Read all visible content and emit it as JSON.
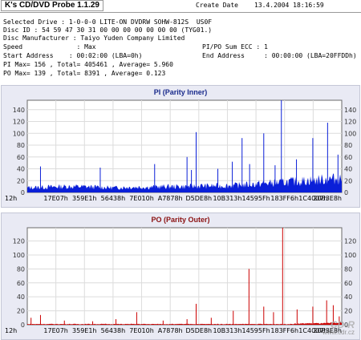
{
  "app": {
    "title": "K's CD/DVD Probe 1.1.29",
    "create_date_label": "Create Date",
    "create_date_value": "13.4.2004 18:16:59"
  },
  "info": {
    "selected_drive": "Selected Drive : 1-0-0-0 LITE-ON DVDRW SOHW-812S  US0F",
    "disc_id": "Disc ID : 54 59 47 30 31 00 00 00 00 00 00 00 (TYG01.)",
    "disc_manufacturer": "Disc Manufacturer : Taiyo Yuden Company Limited",
    "speed": "Speed              : Max",
    "pipo_sum": "PI/PO Sum ECC : 1",
    "start_address": "Start Address    : 00:02:00 (LBA=0h)",
    "end_address": "End Address     : 00:00:00 (LBA=20FFDDh)",
    "pi_stats": "PI Max= 156 , Total= 405461 , Average= 5.960",
    "po_stats": "PO Max= 139 , Total= 8391 , Average= 0.123"
  },
  "chart_data": [
    {
      "type": "bar",
      "title": "PI (Parity Inner)",
      "color": "#0a1fd8",
      "y_ticks": [
        0,
        20,
        40,
        60,
        80,
        100,
        120,
        140
      ],
      "ylim": [
        0,
        156
      ],
      "x_tick_labels": [
        "12h",
        "17E07h",
        "359E1h",
        "56438h",
        "7E010h",
        "A7878h",
        "D5DE8h",
        "10B313h",
        "14595Fh",
        "183FF6h",
        "1C4007h",
        "2083E8h"
      ],
      "baseline": [
        8,
        9,
        10,
        10,
        9,
        8,
        9,
        9,
        10,
        10,
        11,
        11,
        12,
        14,
        16,
        18,
        20,
        22,
        24
      ],
      "spikes": [
        {
          "x": 0.042,
          "value": 44
        },
        {
          "x": 0.232,
          "value": 42
        },
        {
          "x": 0.405,
          "value": 48
        },
        {
          "x": 0.508,
          "value": 60
        },
        {
          "x": 0.522,
          "value": 38
        },
        {
          "x": 0.537,
          "value": 102
        },
        {
          "x": 0.606,
          "value": 40
        },
        {
          "x": 0.652,
          "value": 52
        },
        {
          "x": 0.683,
          "value": 92
        },
        {
          "x": 0.707,
          "value": 48
        },
        {
          "x": 0.752,
          "value": 100
        },
        {
          "x": 0.788,
          "value": 46
        },
        {
          "x": 0.808,
          "value": 156
        },
        {
          "x": 0.856,
          "value": 56
        },
        {
          "x": 0.908,
          "value": 92
        },
        {
          "x": 0.955,
          "value": 118
        },
        {
          "x": 0.988,
          "value": 64
        }
      ]
    },
    {
      "type": "bar",
      "title": "PO (Parity Outer)",
      "color": "#cc0000",
      "y_ticks": [
        0,
        20,
        40,
        60,
        80,
        100,
        120
      ],
      "ylim": [
        0,
        139
      ],
      "x_tick_labels": [
        "12h",
        "17E07h",
        "359E1h",
        "56438h",
        "7E010h",
        "A7878h",
        "D5DE8h",
        "10B313h",
        "14595Fh",
        "183FF6h",
        "1C4007h",
        "2083E8h"
      ],
      "baseline": [
        1,
        1,
        1,
        1,
        1,
        1,
        1,
        1,
        1,
        1,
        1,
        1,
        1,
        1,
        1,
        1,
        2,
        2,
        3
      ],
      "spikes": [
        {
          "x": 0.012,
          "value": 10
        },
        {
          "x": 0.042,
          "value": 14
        },
        {
          "x": 0.118,
          "value": 6
        },
        {
          "x": 0.208,
          "value": 5
        },
        {
          "x": 0.282,
          "value": 8
        },
        {
          "x": 0.348,
          "value": 18
        },
        {
          "x": 0.432,
          "value": 6
        },
        {
          "x": 0.508,
          "value": 8
        },
        {
          "x": 0.537,
          "value": 30
        },
        {
          "x": 0.585,
          "value": 10
        },
        {
          "x": 0.655,
          "value": 20
        },
        {
          "x": 0.705,
          "value": 80
        },
        {
          "x": 0.752,
          "value": 26
        },
        {
          "x": 0.783,
          "value": 18
        },
        {
          "x": 0.812,
          "value": 139
        },
        {
          "x": 0.858,
          "value": 22
        },
        {
          "x": 0.908,
          "value": 26
        },
        {
          "x": 0.952,
          "value": 35
        },
        {
          "x": 0.973,
          "value": 28
        },
        {
          "x": 0.992,
          "value": 12
        }
      ]
    }
  ],
  "watermark": {
    "line1": "CD-R",
    "line2": "www.cdr.cz"
  }
}
